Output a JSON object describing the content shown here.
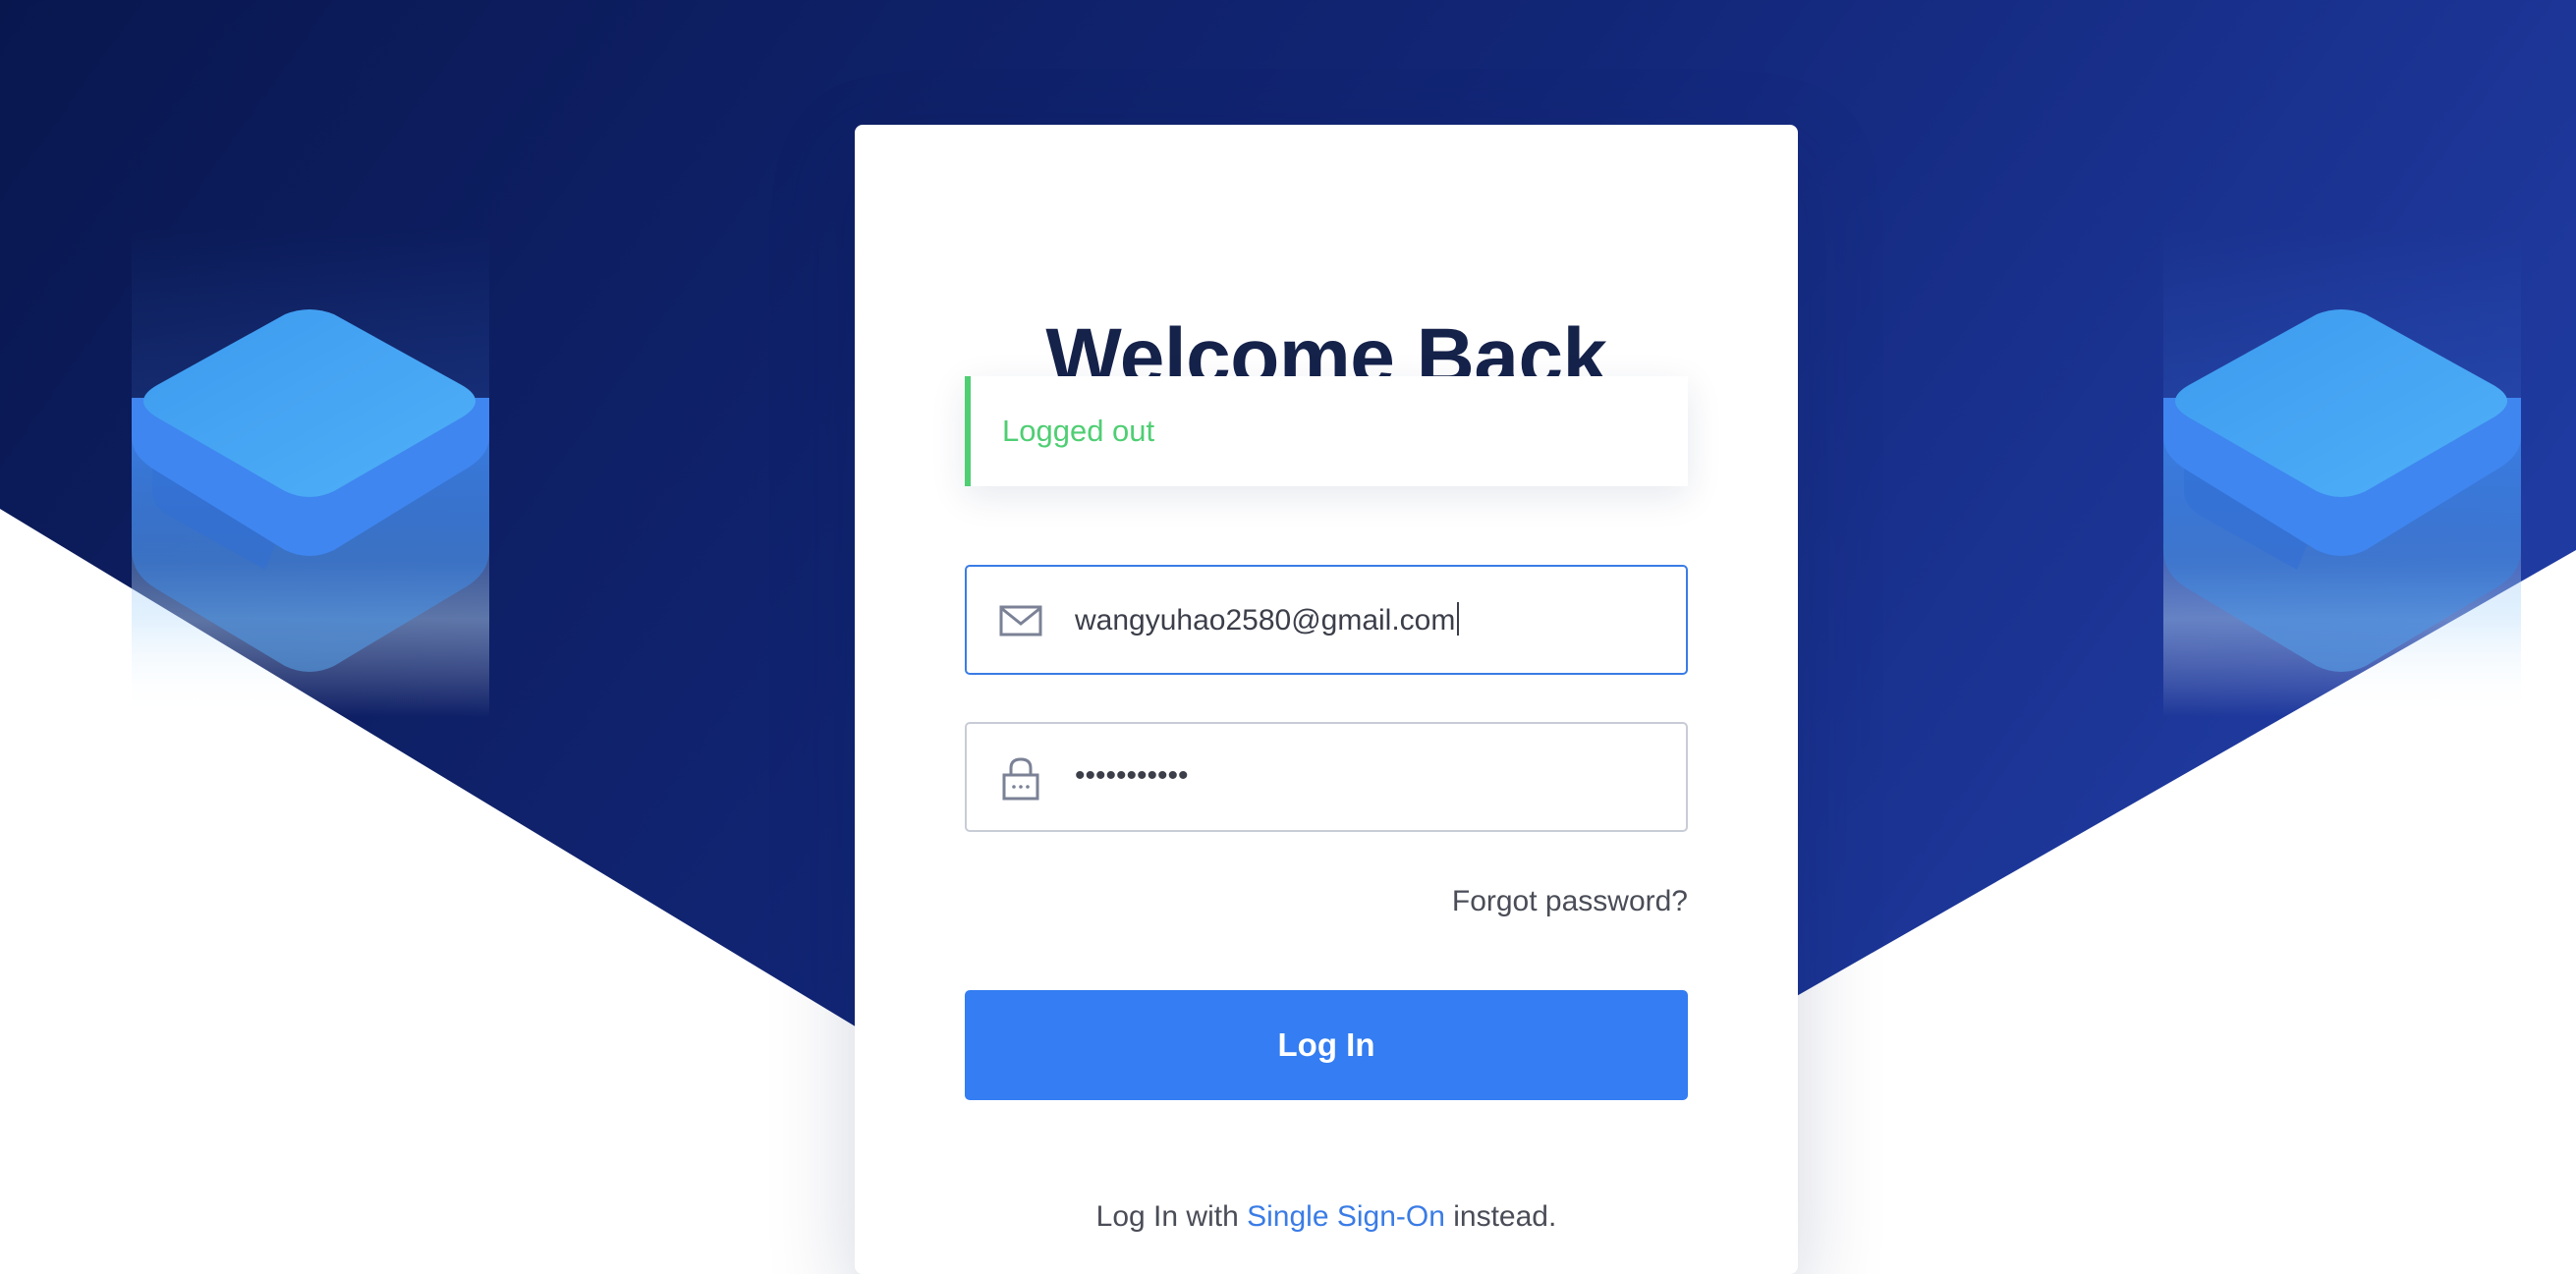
{
  "login": {
    "title": "Welcome Back",
    "alert": "Logged out",
    "email_value": "wangyuhao2580@gmail.com",
    "password_value": "•••••••••••",
    "forgot_label": "Forgot password?",
    "submit_label": "Log In",
    "sso_prefix": "Log In with",
    "sso_link": "Single Sign-On",
    "sso_suffix": "instead."
  },
  "icons": {
    "email": "envelope-icon",
    "password": "lock-icon"
  },
  "colors": {
    "background_dark": "#0b1a58",
    "background_light": "#1f3aa0",
    "accent": "#347df2",
    "success": "#4fce73",
    "title": "#15224a"
  }
}
